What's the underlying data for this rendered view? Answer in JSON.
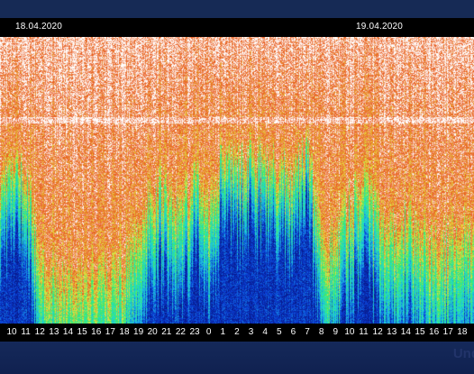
{
  "chart_data": {
    "type": "heatmap",
    "title": "",
    "xlabel": "",
    "ylabel": "",
    "date_labels": [
      "18.04.2020",
      "19.04.2020"
    ],
    "hour_labels": [
      "10",
      "11",
      "12",
      "13",
      "14",
      "15",
      "16",
      "17",
      "18",
      "19",
      "20",
      "21",
      "22",
      "23",
      "0",
      "1",
      "2",
      "3",
      "4",
      "5",
      "6",
      "7",
      "8",
      "9",
      "10",
      "11",
      "12",
      "13",
      "14",
      "15",
      "16",
      "17",
      "18"
    ],
    "colorscale": [
      "#081a8c",
      "#0a3fd6",
      "#1aa0e6",
      "#22e0c8",
      "#3be86a",
      "#e8e040",
      "#e85a1e",
      "#ffffff"
    ],
    "intensity_by_hour": [
      {
        "hour": "10",
        "level": 0.55
      },
      {
        "hour": "11",
        "level": 0.5
      },
      {
        "hour": "12",
        "level": 0.92
      },
      {
        "hour": "13",
        "level": 0.97
      },
      {
        "hour": "14",
        "level": 0.98
      },
      {
        "hour": "15",
        "level": 0.97
      },
      {
        "hour": "16",
        "level": 0.95
      },
      {
        "hour": "17",
        "level": 0.93
      },
      {
        "hour": "18",
        "level": 0.9
      },
      {
        "hour": "19",
        "level": 0.75
      },
      {
        "hour": "20",
        "level": 0.62
      },
      {
        "hour": "21",
        "level": 0.6
      },
      {
        "hour": "22",
        "level": 0.7
      },
      {
        "hour": "23",
        "level": 0.55
      },
      {
        "hour": "0",
        "level": 0.72
      },
      {
        "hour": "1",
        "level": 0.45
      },
      {
        "hour": "2",
        "level": 0.5
      },
      {
        "hour": "3",
        "level": 0.48
      },
      {
        "hour": "4",
        "level": 0.5
      },
      {
        "hour": "5",
        "level": 0.52
      },
      {
        "hour": "6",
        "level": 0.55
      },
      {
        "hour": "7",
        "level": 0.4
      },
      {
        "hour": "8",
        "level": 0.85
      },
      {
        "hour": "9",
        "level": 0.82
      },
      {
        "hour": "10",
        "level": 0.65
      },
      {
        "hour": "11",
        "level": 0.6
      },
      {
        "hour": "12",
        "level": 0.7
      },
      {
        "hour": "13",
        "level": 0.78
      },
      {
        "hour": "14",
        "level": 0.72
      },
      {
        "hour": "15",
        "level": 0.8
      },
      {
        "hour": "16",
        "level": 0.82
      },
      {
        "hour": "17",
        "level": 0.8
      },
      {
        "hour": "18",
        "level": 0.78
      }
    ],
    "grid": false,
    "legend": "none"
  },
  "watermark": "Und"
}
